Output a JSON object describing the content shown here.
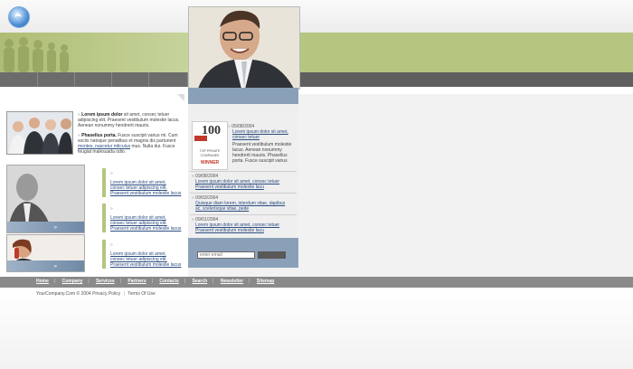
{
  "intro": {
    "para1_bold": "Lorem ipsum dolor",
    "para1_text": "sit amet, consec tetuer adipiscing elit. Praesent vestibulum molestie lacus. Aenean nonummy hendrerit mauris.",
    "para2_bold": "Phasellus porta.",
    "para2_text": "Fusce suscipit varius mi. Cum sociis natoque penatibus et magnis dis parturient",
    "para2_link": "montes, nascetur ridiculus",
    "para2_tail": "mus. Nulla dui. Fusce feugiat malesuada odio."
  },
  "features": [
    {
      "line1": "Lorem ipsum dolor sit amet,",
      "line2": "consec tetuer adipiscing elit.",
      "line3": "Praesent vestibulum molestie lacus"
    },
    {
      "line1": "Lorem ipsum dolor sit amet,",
      "line2": "consec tetuer adipiscing elit.",
      "line3": "Praesent vestibulum molestie lacus"
    },
    {
      "line1": "Lorem ipsum dolor sit amet,",
      "line2": "consec tetuer adipiscing elit.",
      "line3": "Praesent vestibulum molestie lacus"
    }
  ],
  "award": {
    "number": "100",
    "line1": "TOP PRIVATE",
    "line2": "COMPANIES",
    "winner": "WINNER"
  },
  "news_top": {
    "date": "05/08/2004",
    "link1": "Lorem ipsum dolor sit amet,",
    "link2": "consec tetuer",
    "text": "Praesent vestibulum molestie lacus. Aenean nonummy hendrerit mauris. Phasellus porta. Fusce suscipit varius"
  },
  "news": [
    {
      "date": "09/08/2004",
      "link1": "Lorem ipsum dolor sit amet, consec tetuer",
      "link2": "Praesent vestibulum molestie lacu"
    },
    {
      "date": "09/03/2004",
      "link1": "Quisque diam lorem, interdum vitae, dapibus",
      "link2": "ac, scelerisque vitae, pede"
    },
    {
      "date": "09/01/2004",
      "link1": "Lorem ipsum dolor sit amet, consec tetuer",
      "link2": "Praesent vestibulum molestie lacu"
    }
  ],
  "newsletter": {
    "placeholder": "enter email"
  },
  "footer": {
    "links": [
      "Home",
      "Company",
      "Services",
      "Partners",
      "Contacts",
      "Search",
      "Newsletter",
      "Sitemap"
    ],
    "copyright": "YourCompany.Com © 2004",
    "privacy": "Privacy Policy",
    "terms": "Terms Of Use"
  },
  "colors": {
    "accent_green": "#b4c67f",
    "nav_gray": "#5f5f5f",
    "panel_blue": "#8aa0b8",
    "link_blue": "#2c4d80"
  }
}
